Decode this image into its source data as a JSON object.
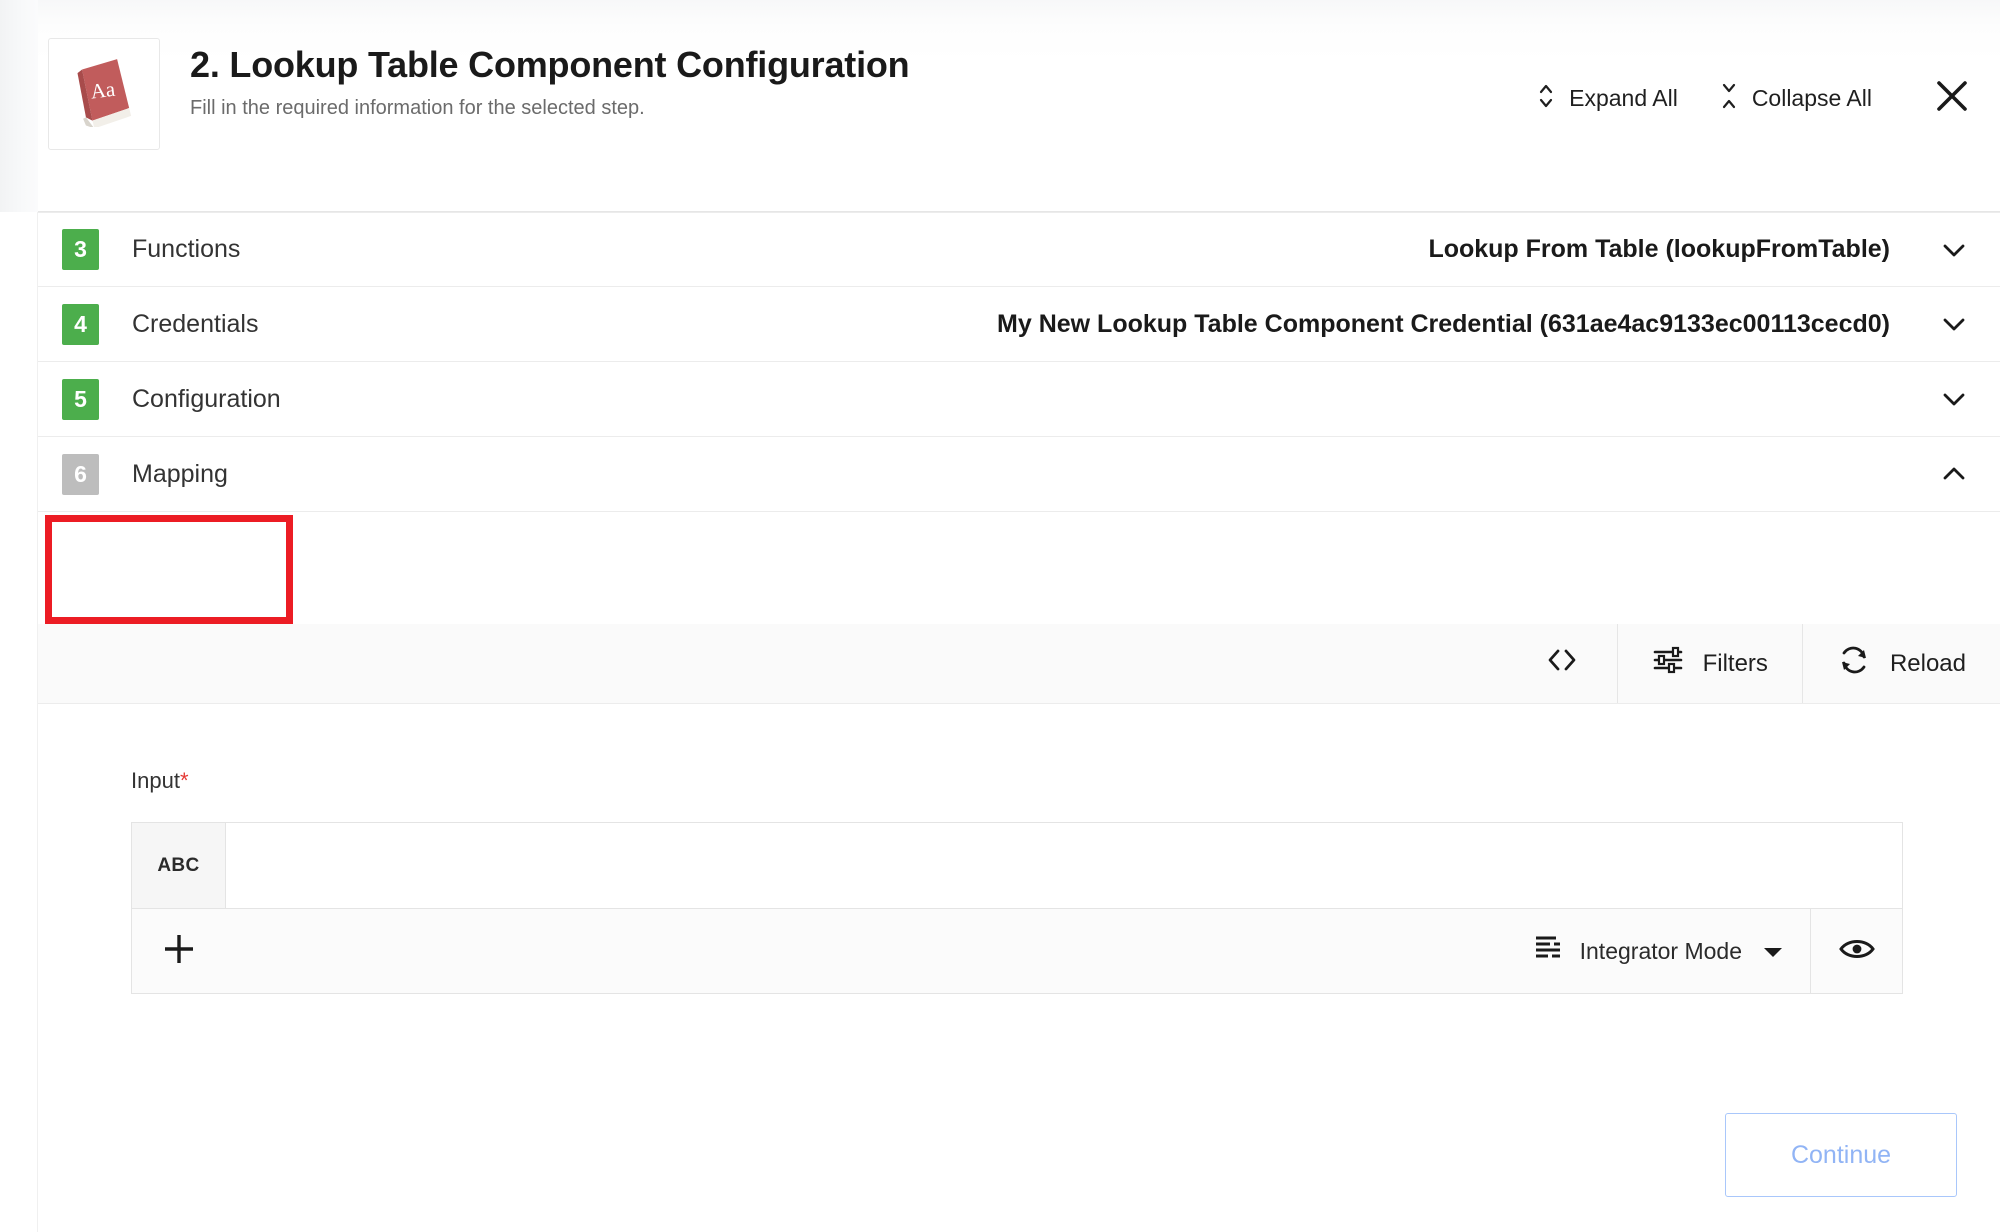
{
  "header": {
    "icon_name": "dictionary-book-icon",
    "icon_letters": "Aa",
    "title": "2. Lookup Table Component Configuration",
    "subtitle": "Fill in the required information for the selected step.",
    "expand_all_label": "Expand All",
    "collapse_all_label": "Collapse All",
    "close_label": "×"
  },
  "accordion": {
    "rows": [
      {
        "number": "3",
        "label": "Functions",
        "value": "Lookup From Table (lookupFromTable)",
        "state": "collapsed",
        "badge_color": "#4cae4c"
      },
      {
        "number": "4",
        "label": "Credentials",
        "value": "My New Lookup Table Component Credential (631ae4ac9133ec00113cecd0)",
        "state": "collapsed",
        "badge_color": "#4cae4c"
      },
      {
        "number": "5",
        "label": "Configuration",
        "value": "",
        "state": "collapsed",
        "badge_color": "#4cae4c"
      },
      {
        "number": "6",
        "label": "Mapping",
        "value": "",
        "state": "expanded",
        "badge_color": "#bdbdbd"
      }
    ]
  },
  "toolbar": {
    "code_icon": "code-brackets-icon",
    "filters_label": "Filters",
    "filters_icon": "filters-sliders-icon",
    "reload_label": "Reload",
    "reload_icon": "reload-refresh-icon"
  },
  "mapping": {
    "input_label": "Input",
    "required_marker": "*",
    "column_header": "ABC",
    "add_row_icon": "plus-icon",
    "mode_label": "Integrator Mode",
    "mode_icon": "list-view-icon",
    "mode_caret": "▼",
    "preview_icon": "eye-icon"
  },
  "footer": {
    "continue_label": "Continue"
  },
  "annotation": {
    "highlight_color": "#ec1c24",
    "highlight_target": "Mapping"
  }
}
